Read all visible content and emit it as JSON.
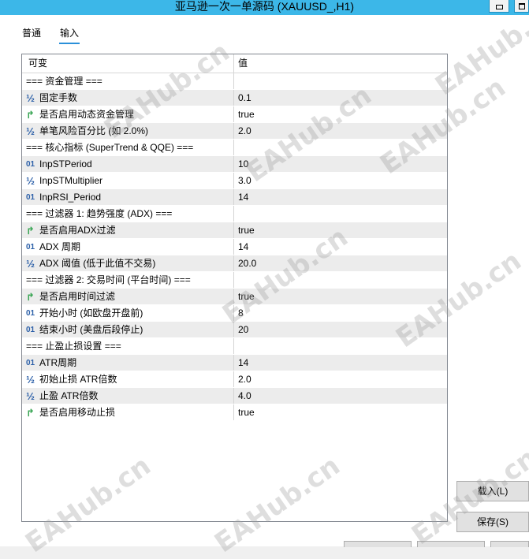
{
  "window": {
    "title": "亚马逊一次一单源码 (XAUUSD_,H1)"
  },
  "tabs": [
    {
      "label": "普通",
      "active": false
    },
    {
      "label": "输入",
      "active": true
    }
  ],
  "grid": {
    "headers": {
      "variable": "可变",
      "value": "值"
    },
    "rows": [
      {
        "type": "section",
        "name": "=== 资金管理 ===",
        "value": ""
      },
      {
        "type": "double",
        "icon": "½",
        "name": "固定手数",
        "value": "0.1"
      },
      {
        "type": "bool",
        "icon": "↱",
        "name": "是否启用动态资金管理",
        "value": "true"
      },
      {
        "type": "double",
        "icon": "½",
        "name": "单笔风险百分比 (如 2.0%)",
        "value": "2.0"
      },
      {
        "type": "section",
        "name": "=== 核心指标 (SuperTrend & QQE) ===",
        "value": ""
      },
      {
        "type": "int",
        "icon": "01",
        "name": "InpSTPeriod",
        "value": "10"
      },
      {
        "type": "double",
        "icon": "½",
        "name": "InpSTMultiplier",
        "value": "3.0"
      },
      {
        "type": "int",
        "icon": "01",
        "name": "InpRSI_Period",
        "value": "14"
      },
      {
        "type": "section",
        "name": "=== 过滤器 1: 趋势强度 (ADX) ===",
        "value": ""
      },
      {
        "type": "bool",
        "icon": "↱",
        "name": "是否启用ADX过滤",
        "value": "true"
      },
      {
        "type": "int",
        "icon": "01",
        "name": "ADX 周期",
        "value": "14"
      },
      {
        "type": "double",
        "icon": "½",
        "name": "ADX 阈值 (低于此值不交易)",
        "value": "20.0"
      },
      {
        "type": "section",
        "name": "=== 过滤器 2: 交易时间 (平台时间) ===",
        "value": ""
      },
      {
        "type": "bool",
        "icon": "↱",
        "name": "是否启用时间过滤",
        "value": "true"
      },
      {
        "type": "int",
        "icon": "01",
        "name": "开始小时 (如欧盘开盘前)",
        "value": "8"
      },
      {
        "type": "int",
        "icon": "01",
        "name": "结束小时 (美盘后段停止)",
        "value": "20"
      },
      {
        "type": "section",
        "name": "=== 止盈止损设置 ===",
        "value": ""
      },
      {
        "type": "int",
        "icon": "01",
        "name": "ATR周期",
        "value": "14"
      },
      {
        "type": "double",
        "icon": "½",
        "name": "初始止损 ATR倍数",
        "value": "2.0"
      },
      {
        "type": "double",
        "icon": "½",
        "name": "止盈 ATR倍数",
        "value": "4.0"
      },
      {
        "type": "bool",
        "icon": "↱",
        "name": "是否启用移动止损",
        "value": "true"
      }
    ]
  },
  "buttons": {
    "load": "载入(L)",
    "save": "保存(S)"
  },
  "watermark": "EAHub.cn"
}
